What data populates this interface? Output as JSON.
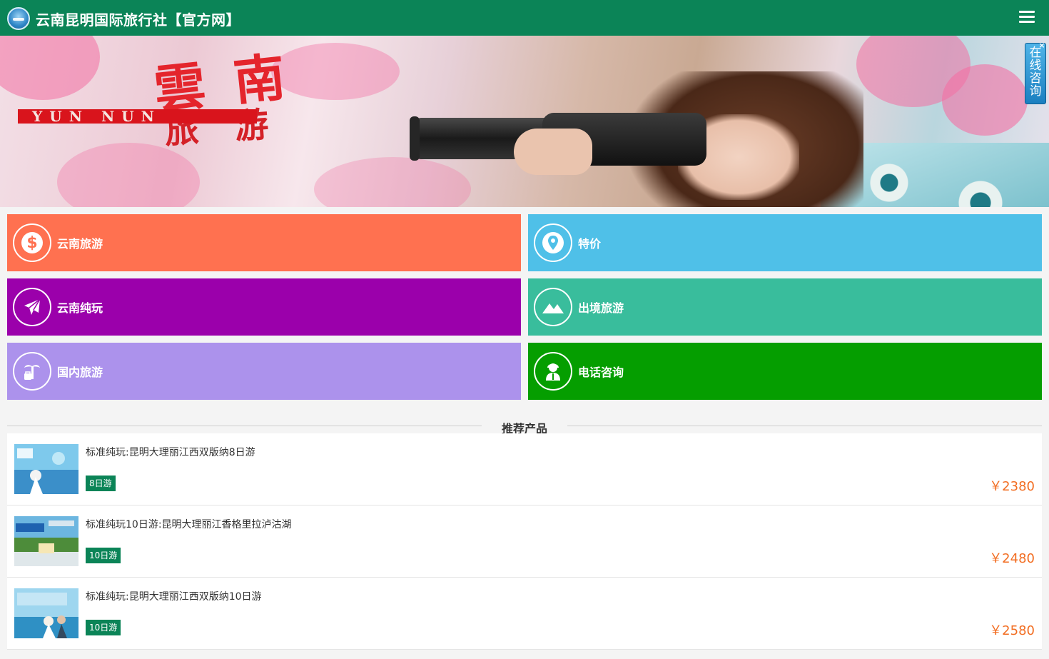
{
  "header": {
    "title": "云南昆明国际旅行社【官方网】",
    "logo_icon": "globe-logo-icon",
    "menu_icon": "hamburger-menu-icon",
    "bg_color": "#0b8457"
  },
  "banner": {
    "headline": "雲南",
    "subline": "旅游",
    "strip_text": "YUN NUN"
  },
  "chat_widget": {
    "label": "在线咨询",
    "close": "×"
  },
  "tiles": [
    {
      "label": "云南旅游",
      "icon": "dollar-icon",
      "color": "#ff7150"
    },
    {
      "label": "特价",
      "icon": "map-pin-icon",
      "color": "#4fc0e8"
    },
    {
      "label": "云南纯玩",
      "icon": "airplane-icon",
      "color": "#9b00ab"
    },
    {
      "label": "出境旅游",
      "icon": "mountain-icon",
      "color": "#39bd9c"
    },
    {
      "label": "国内旅游",
      "icon": "palm-luggage-icon",
      "color": "#ac92ec"
    },
    {
      "label": "电话咨询",
      "icon": "customer-service-icon",
      "color": "#059e00"
    }
  ],
  "recommended": {
    "title": "推荐产品",
    "products": [
      {
        "title": "标准纯玩:昆明大理丽江西双版纳8日游",
        "tag": "8日游",
        "price": "￥2380"
      },
      {
        "title": "标准纯玩10日游:昆明大理丽江香格里拉泸沽湖",
        "tag": "10日游",
        "price": "￥2480"
      },
      {
        "title": "标准纯玩:昆明大理丽江西双版纳10日游",
        "tag": "10日游",
        "price": "￥2580"
      }
    ]
  },
  "colors": {
    "accent_green": "#0b8457",
    "price_orange": "#f26d21"
  }
}
